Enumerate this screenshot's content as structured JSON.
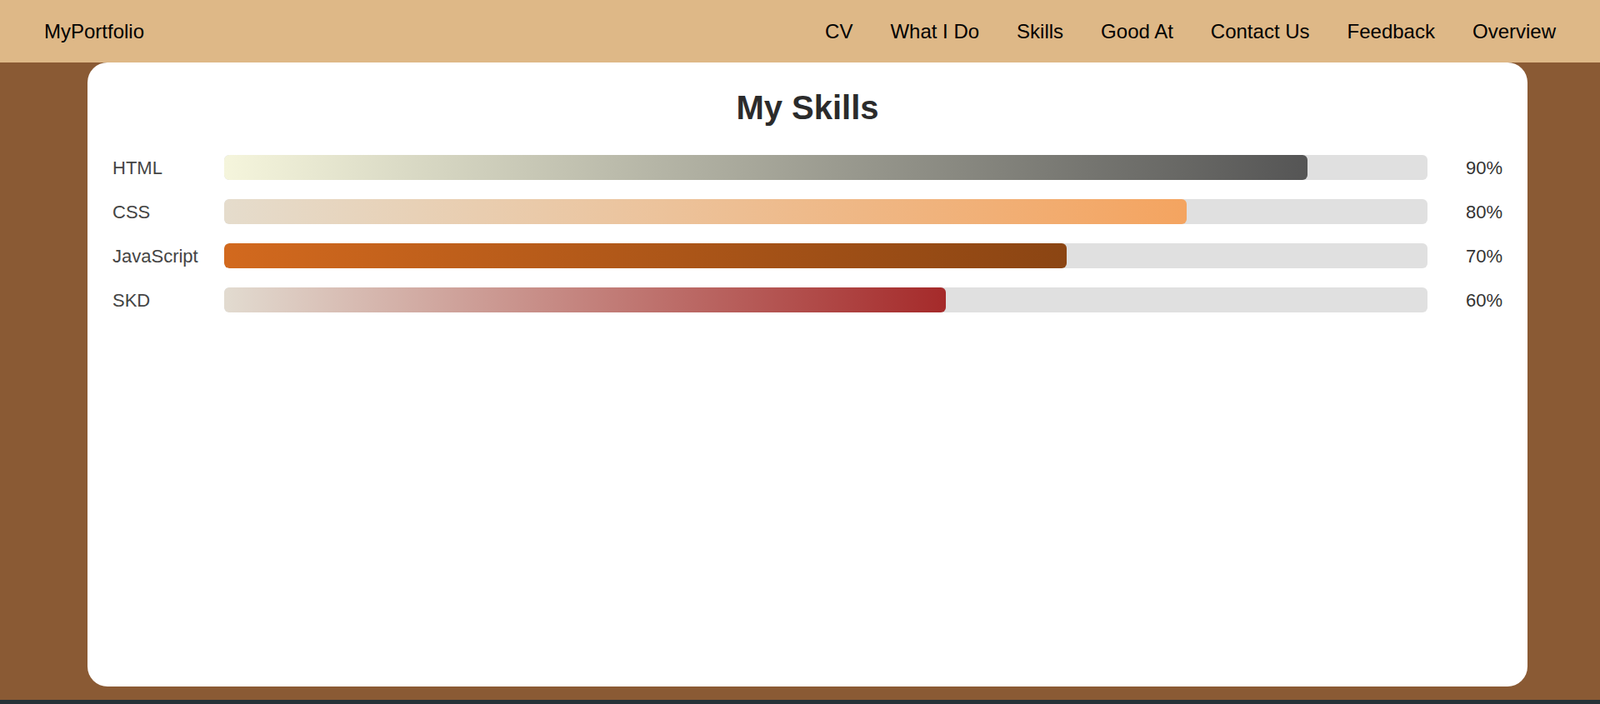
{
  "nav": {
    "brand": "MyPortfolio",
    "links": [
      {
        "label": "CV"
      },
      {
        "label": "What I Do"
      },
      {
        "label": "Skills"
      },
      {
        "label": "Good At"
      },
      {
        "label": "Contact Us"
      },
      {
        "label": "Feedback"
      },
      {
        "label": "Overview"
      }
    ]
  },
  "skills_card": {
    "title": "My Skills",
    "skills": [
      {
        "name": "HTML",
        "level": 0.9,
        "reading": "90%",
        "color_start": "#f5f5dc",
        "color": "#555555"
      },
      {
        "name": "CSS",
        "level": 0.8,
        "reading": "80%",
        "color_start": "#e5dccc",
        "color": "#f4a460"
      },
      {
        "name": "JavaScript",
        "level": 0.7,
        "reading": "70%",
        "color_start": "#d2691e",
        "color": "#8b4513"
      },
      {
        "name": "SKD",
        "level": 0.6,
        "reading": "60%",
        "color_start": "#e2dbd0",
        "color": "#a52a2a"
      }
    ]
  }
}
